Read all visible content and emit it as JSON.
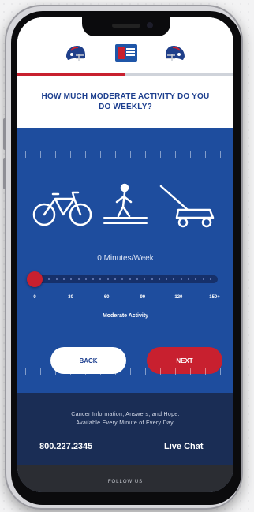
{
  "header": {
    "question": "HOW MUCH MODERATE ACTIVITY DO YOU DO WEEKLY?"
  },
  "activity": {
    "minutes_text": "0 Minutes/Week",
    "value_minutes": 0,
    "scale": [
      "0",
      "30",
      "60",
      "90",
      "120",
      "150+"
    ],
    "scale_label": "Moderate Activity",
    "icons": [
      "bicycle-icon",
      "walking-person-icon",
      "lawn-mower-icon"
    ]
  },
  "buttons": {
    "back": "BACK",
    "next": "NEXT"
  },
  "footer": {
    "tagline_1": "Cancer Information, Answers, and Hope.",
    "tagline_2": "Available Every Minute of Every Day.",
    "phone": "800.227.2345",
    "live_chat": "Live Chat",
    "follow": "FOLLOW US"
  },
  "colors": {
    "brand_blue": "#1e4d9e",
    "brand_red": "#c8202f",
    "footer_navy": "#1a2d55"
  }
}
